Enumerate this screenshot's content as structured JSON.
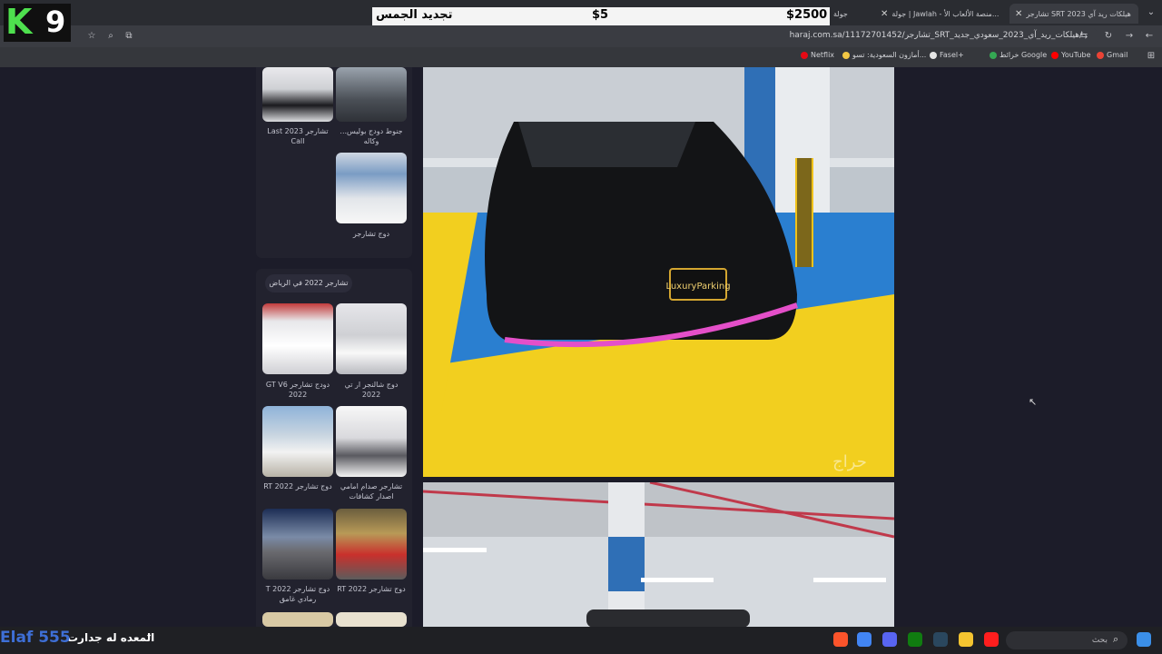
{
  "browser": {
    "tabs": [
      {
        "title": "تشارجر SRT هيلكات ريد آي 2023",
        "active": true
      },
      {
        "title": "جولة | Jawlah - منصة الألعاب الأ...",
        "active": false
      },
      {
        "title": "جولة",
        "active": false
      }
    ],
    "url": "haraj.com.sa/11172701452/تشارجر_SRT_هيلكات_ريد_آي_2023_سعودي_جديد/",
    "bookmarks": [
      "Gmail",
      "YouTube",
      "خرائط Google",
      "Fasel+",
      "أمازون السعودية: تسو...",
      "Netflix"
    ]
  },
  "overlay": {
    "logo_letter": "K",
    "logo_number": "9",
    "banner": {
      "left": "$2500",
      "middle": "$5",
      "right": "تجديد الجمس"
    }
  },
  "sidebar": {
    "top_items": [
      {
        "caption": "جنوط دودج بوليس... وكاله"
      },
      {
        "caption": "تشارجر Last 2023 Call"
      },
      {
        "caption": "دوج تشارجر"
      }
    ],
    "section_title": "تشارجر 2022 في الرياض",
    "items": [
      {
        "caption": "دوج شالنجر ار تي 2022"
      },
      {
        "caption": "دودج تشارجر GT V6 2022"
      },
      {
        "caption": "تشارجر صدام امامي اصدار كشافات"
      },
      {
        "caption": "دوج تشارجر RT 2022"
      },
      {
        "caption": "دوج تشارجر RT 2022"
      },
      {
        "caption": "دوج تشارجر T 2022 رمادي غامق"
      }
    ]
  },
  "listing": {
    "photo_plate": "LuxuryParking",
    "watermark": "حراج"
  },
  "taskbar": {
    "left_text": "المعده له جدارت",
    "overlay_text": "Elaf 555",
    "search_placeholder": "بحث"
  }
}
